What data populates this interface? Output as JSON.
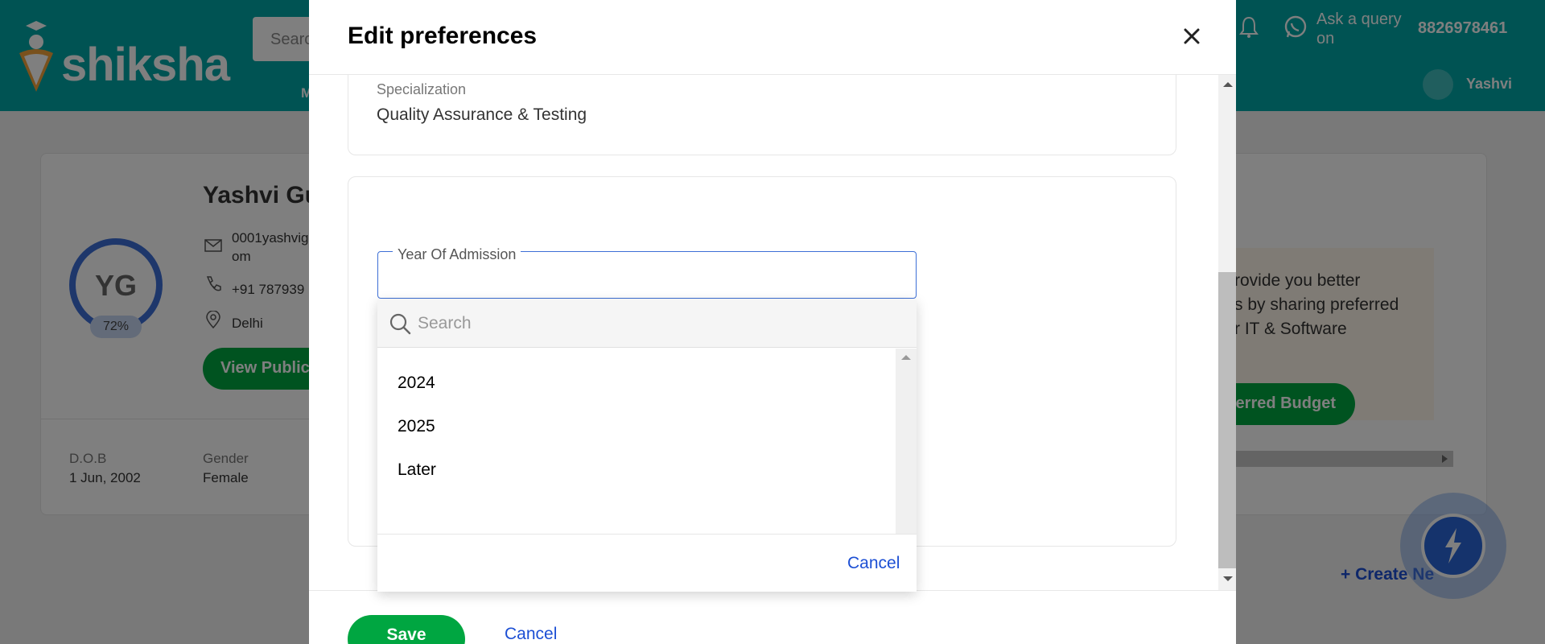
{
  "background": {
    "brand": "shiksha",
    "search_placeholder": "Searc",
    "nav_partial": "M",
    "ask_query": "Ask a query on",
    "phone": "8826978461",
    "user_name": "Yashvi",
    "profile": {
      "initials": "YG",
      "completion": "72%",
      "name": "Yashvi Gu",
      "email": "0001yashvig om",
      "phone": "+91 787939",
      "city": "Delhi",
      "view_button": "View Public",
      "dob_label": "D.O.B",
      "dob_value": "1 Jun, 2002",
      "gender_label": "Gender",
      "gender_value": "Female"
    },
    "budget_text": "rovide you better\ns by sharing preferred\nr IT & Software",
    "budget_button": "erred Budget",
    "create_new": "+ Create Ne"
  },
  "modal": {
    "title": "Edit preferences",
    "specialization_label": "Specialization",
    "specialization_value": "Quality Assurance & Testing",
    "year_field_label": "Year Of Admission",
    "dropdown": {
      "search_placeholder": "Search",
      "options": [
        "2024",
        "2025",
        "Later"
      ],
      "cancel_label": "Cancel"
    },
    "save_label": "Save",
    "cancel_label": "Cancel"
  },
  "colors": {
    "brand_teal": "#00a6a6",
    "primary_green": "#00a641",
    "link_blue": "#1c4fd4",
    "focus_blue": "#3d6fd6"
  }
}
